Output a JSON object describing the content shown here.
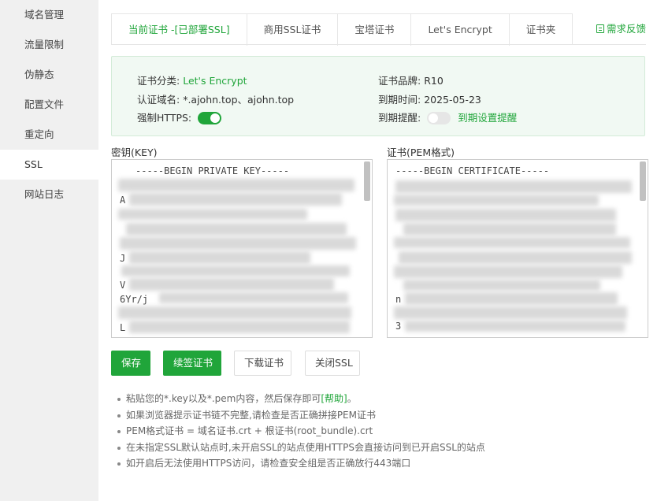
{
  "sidebar": {
    "items": [
      {
        "label": "域名管理"
      },
      {
        "label": "流量限制"
      },
      {
        "label": "伪静态"
      },
      {
        "label": "配置文件"
      },
      {
        "label": "重定向"
      },
      {
        "label": "SSL",
        "active": true
      },
      {
        "label": "网站日志"
      }
    ]
  },
  "tabs": [
    {
      "label": "当前证书 -[已部署SSL]",
      "active": true
    },
    {
      "label": "商用SSL证书"
    },
    {
      "label": "宝塔证书"
    },
    {
      "label": "Let's Encrypt"
    },
    {
      "label": "证书夹"
    }
  ],
  "feedback_label": "需求反馈",
  "cert_info": {
    "category_label": "证书分类:",
    "category_value": "Let's Encrypt",
    "brand_label": "证书品牌:",
    "brand_value": "R10",
    "domain_label": "认证域名:",
    "domain_value": "*.ajohn.top、ajohn.top",
    "expire_label": "到期时间:",
    "expire_value": "2025-05-23",
    "https_label": "强制HTTPS:",
    "https_enabled": true,
    "reminder_label": "到期提醒:",
    "reminder_enabled": false,
    "reminder_link": "到期设置提醒"
  },
  "key_area": {
    "label": "密钥(KEY)",
    "first_line": "-----BEGIN PRIVATE KEY-----",
    "partial_lines": [
      "A",
      "J",
      "V",
      "6Yr/j",
      "L"
    ]
  },
  "cert_area": {
    "label": "证书(PEM格式)",
    "first_line": "-----BEGIN CERTIFICATE-----",
    "partial_lines": [
      "n",
      "3"
    ]
  },
  "buttons": {
    "save": "保存",
    "renew": "续签证书",
    "download": "下载证书",
    "close_ssl": "关闭SSL"
  },
  "tips": {
    "tip1_text": "粘贴您的*.key以及*.pem内容，然后保存即可",
    "tip1_link": "[帮助]",
    "tip1_end": "。",
    "tip2": "如果浏览器提示证书链不完整,请检查是否正确拼接PEM证书",
    "tip3": "PEM格式证书 = 域名证书.crt + 根证书(root_bundle).crt",
    "tip4": "在未指定SSL默认站点时,未开启SSL的站点使用HTTPS会直接访问到已开启SSL的站点",
    "tip5": "如开启后无法使用HTTPS访问，请检查安全组是否正确放行443端口"
  },
  "colors": {
    "accent": "#20a53a",
    "sidebar_bg": "#f0f0f0",
    "info_bg": "#f1f9f3"
  }
}
